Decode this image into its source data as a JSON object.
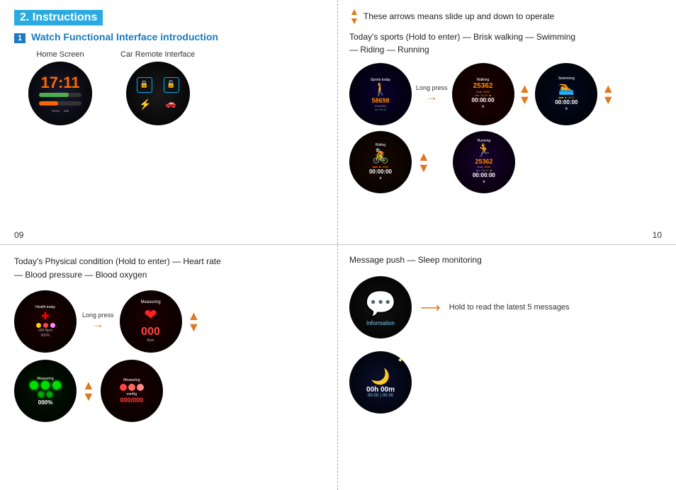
{
  "sections": {
    "title": "2. Instructions",
    "sub_title_1": "Watch Functional Interface introduction",
    "sub_title_1_num": "1",
    "home_screen_label": "Home Screen",
    "car_remote_label": "Car Remote Interface",
    "arrows_note": "These arrows means slide up and down to operate",
    "sports_desc_line1": "Today's sports (Hold to enter) — Brisk walking — Swimming",
    "sports_desc_line2": "— Riding — Running",
    "page_left": "09",
    "page_right": "10",
    "physical_line1": "Today's Physical condition (Hold to enter) — Heart rate",
    "physical_line2": "— Blood pressure — Blood oxygen",
    "message_desc": "Message push — Sleep monitoring",
    "hold_message_label": "Hold to read the latest 5 messages",
    "long_press_label": "Long press",
    "sports_today_title": "Sports today",
    "sports_today_number": "58698",
    "walking_title": "Walking",
    "walking_number": "25362",
    "swimming_title": "Swimming",
    "riding_title": "Riding",
    "running_title": "Running",
    "running_number": "25362",
    "health_today_title": "Health today",
    "measuring_title": "Measuring",
    "measuring_number": "000",
    "information_label": "Information",
    "time_display": "00:00:00"
  }
}
